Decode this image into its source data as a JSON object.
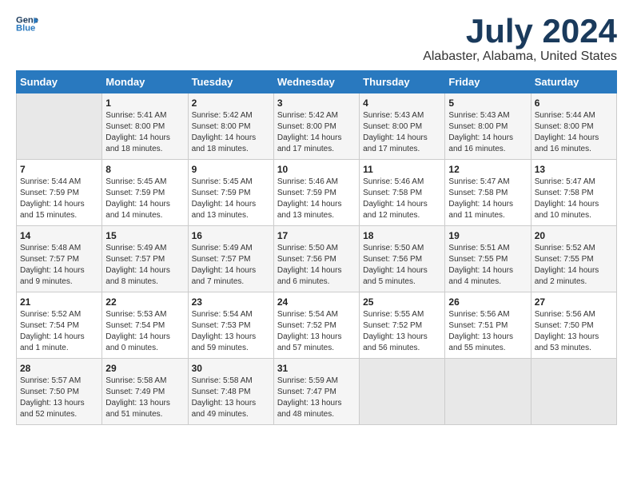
{
  "logo": {
    "line1": "General",
    "line2": "Blue"
  },
  "title": "July 2024",
  "subtitle": "Alabaster, Alabama, United States",
  "headers": [
    "Sunday",
    "Monday",
    "Tuesday",
    "Wednesday",
    "Thursday",
    "Friday",
    "Saturday"
  ],
  "weeks": [
    [
      {
        "day": "",
        "text": ""
      },
      {
        "day": "1",
        "text": "Sunrise: 5:41 AM\nSunset: 8:00 PM\nDaylight: 14 hours\nand 18 minutes."
      },
      {
        "day": "2",
        "text": "Sunrise: 5:42 AM\nSunset: 8:00 PM\nDaylight: 14 hours\nand 18 minutes."
      },
      {
        "day": "3",
        "text": "Sunrise: 5:42 AM\nSunset: 8:00 PM\nDaylight: 14 hours\nand 17 minutes."
      },
      {
        "day": "4",
        "text": "Sunrise: 5:43 AM\nSunset: 8:00 PM\nDaylight: 14 hours\nand 17 minutes."
      },
      {
        "day": "5",
        "text": "Sunrise: 5:43 AM\nSunset: 8:00 PM\nDaylight: 14 hours\nand 16 minutes."
      },
      {
        "day": "6",
        "text": "Sunrise: 5:44 AM\nSunset: 8:00 PM\nDaylight: 14 hours\nand 16 minutes."
      }
    ],
    [
      {
        "day": "7",
        "text": "Sunrise: 5:44 AM\nSunset: 7:59 PM\nDaylight: 14 hours\nand 15 minutes."
      },
      {
        "day": "8",
        "text": "Sunrise: 5:45 AM\nSunset: 7:59 PM\nDaylight: 14 hours\nand 14 minutes."
      },
      {
        "day": "9",
        "text": "Sunrise: 5:45 AM\nSunset: 7:59 PM\nDaylight: 14 hours\nand 13 minutes."
      },
      {
        "day": "10",
        "text": "Sunrise: 5:46 AM\nSunset: 7:59 PM\nDaylight: 14 hours\nand 13 minutes."
      },
      {
        "day": "11",
        "text": "Sunrise: 5:46 AM\nSunset: 7:58 PM\nDaylight: 14 hours\nand 12 minutes."
      },
      {
        "day": "12",
        "text": "Sunrise: 5:47 AM\nSunset: 7:58 PM\nDaylight: 14 hours\nand 11 minutes."
      },
      {
        "day": "13",
        "text": "Sunrise: 5:47 AM\nSunset: 7:58 PM\nDaylight: 14 hours\nand 10 minutes."
      }
    ],
    [
      {
        "day": "14",
        "text": "Sunrise: 5:48 AM\nSunset: 7:57 PM\nDaylight: 14 hours\nand 9 minutes."
      },
      {
        "day": "15",
        "text": "Sunrise: 5:49 AM\nSunset: 7:57 PM\nDaylight: 14 hours\nand 8 minutes."
      },
      {
        "day": "16",
        "text": "Sunrise: 5:49 AM\nSunset: 7:57 PM\nDaylight: 14 hours\nand 7 minutes."
      },
      {
        "day": "17",
        "text": "Sunrise: 5:50 AM\nSunset: 7:56 PM\nDaylight: 14 hours\nand 6 minutes."
      },
      {
        "day": "18",
        "text": "Sunrise: 5:50 AM\nSunset: 7:56 PM\nDaylight: 14 hours\nand 5 minutes."
      },
      {
        "day": "19",
        "text": "Sunrise: 5:51 AM\nSunset: 7:55 PM\nDaylight: 14 hours\nand 4 minutes."
      },
      {
        "day": "20",
        "text": "Sunrise: 5:52 AM\nSunset: 7:55 PM\nDaylight: 14 hours\nand 2 minutes."
      }
    ],
    [
      {
        "day": "21",
        "text": "Sunrise: 5:52 AM\nSunset: 7:54 PM\nDaylight: 14 hours\nand 1 minute."
      },
      {
        "day": "22",
        "text": "Sunrise: 5:53 AM\nSunset: 7:54 PM\nDaylight: 14 hours\nand 0 minutes."
      },
      {
        "day": "23",
        "text": "Sunrise: 5:54 AM\nSunset: 7:53 PM\nDaylight: 13 hours\nand 59 minutes."
      },
      {
        "day": "24",
        "text": "Sunrise: 5:54 AM\nSunset: 7:52 PM\nDaylight: 13 hours\nand 57 minutes."
      },
      {
        "day": "25",
        "text": "Sunrise: 5:55 AM\nSunset: 7:52 PM\nDaylight: 13 hours\nand 56 minutes."
      },
      {
        "day": "26",
        "text": "Sunrise: 5:56 AM\nSunset: 7:51 PM\nDaylight: 13 hours\nand 55 minutes."
      },
      {
        "day": "27",
        "text": "Sunrise: 5:56 AM\nSunset: 7:50 PM\nDaylight: 13 hours\nand 53 minutes."
      }
    ],
    [
      {
        "day": "28",
        "text": "Sunrise: 5:57 AM\nSunset: 7:50 PM\nDaylight: 13 hours\nand 52 minutes."
      },
      {
        "day": "29",
        "text": "Sunrise: 5:58 AM\nSunset: 7:49 PM\nDaylight: 13 hours\nand 51 minutes."
      },
      {
        "day": "30",
        "text": "Sunrise: 5:58 AM\nSunset: 7:48 PM\nDaylight: 13 hours\nand 49 minutes."
      },
      {
        "day": "31",
        "text": "Sunrise: 5:59 AM\nSunset: 7:47 PM\nDaylight: 13 hours\nand 48 minutes."
      },
      {
        "day": "",
        "text": ""
      },
      {
        "day": "",
        "text": ""
      },
      {
        "day": "",
        "text": ""
      }
    ]
  ]
}
